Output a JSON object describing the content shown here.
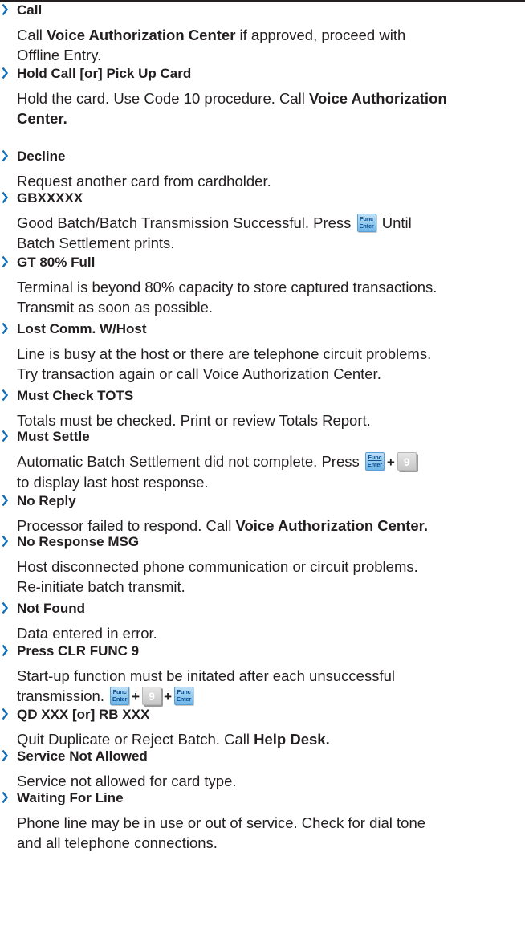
{
  "entries": [
    {
      "title": "Call",
      "desc": [
        [
          {
            "t": "Call "
          },
          {
            "t": "Voice Authorization Center",
            "b": true
          },
          {
            "t": " if approved, proceed with"
          }
        ],
        [
          {
            "t": "Offline Entry."
          }
        ]
      ]
    },
    {
      "title": "Hold Call [or] Pick Up Card",
      "desc": [
        [
          {
            "t": "Hold the card. Use Code 10 procedure. Call "
          },
          {
            "t": "Voice Authorization",
            "b": true
          }
        ],
        [
          {
            "t": "Center.",
            "b": true
          }
        ]
      ]
    },
    {
      "title": "Decline",
      "desc": [
        [
          {
            "t": "Request another card from cardholder."
          }
        ]
      ]
    },
    {
      "title": "GBXXXXX",
      "desc": [
        [
          {
            "t": "Good Batch/Batch Transmission Successful. Press "
          },
          {
            "k": "func"
          },
          {
            "t": " Until"
          }
        ],
        [
          {
            "t": "Batch Settlement prints."
          }
        ]
      ]
    },
    {
      "title": "GT 80% Full",
      "desc": [
        [
          {
            "t": "Terminal is beyond 80% capacity to store captured transactions."
          }
        ],
        [
          {
            "t": "Transmit as soon as possible."
          }
        ]
      ]
    },
    {
      "title": "Lost Comm. W/Host",
      "desc": [
        [
          {
            "t": "Line is busy at the host or there are telephone circuit problems."
          }
        ],
        [
          {
            "t": "Try transaction again or call Voice Authorization Center."
          }
        ]
      ]
    },
    {
      "title": "Must Check TOTS",
      "desc": [
        [
          {
            "t": "Totals must be checked. Print or review Totals Report."
          }
        ]
      ]
    },
    {
      "title": "Must Settle",
      "desc": [
        [
          {
            "t": "Automatic Batch Settlement did not complete. Press "
          },
          {
            "k": "func"
          },
          {
            "t": " + ",
            "plus": true
          },
          {
            "k": "num",
            "v": "9"
          }
        ],
        [
          {
            "t": "to display last host response."
          }
        ]
      ]
    },
    {
      "title": "No Reply",
      "desc": [
        [
          {
            "t": "Processor failed to respond. Call "
          },
          {
            "t": "Voice Authorization Center.",
            "b": true
          }
        ]
      ]
    },
    {
      "title": "No Response MSG",
      "desc": [
        [
          {
            "t": "Host disconnected phone communication or circuit problems."
          }
        ],
        [
          {
            "t": "Re-initiate batch transmit."
          }
        ]
      ]
    },
    {
      "title": "Not Found",
      "desc": [
        [
          {
            "t": "Data entered in error."
          }
        ]
      ]
    },
    {
      "title": "Press CLR FUNC 9",
      "desc": [
        [
          {
            "t": "Start-up function must be initated after each unsuccessful"
          }
        ],
        [
          {
            "t": "transmission. "
          },
          {
            "k": "func"
          },
          {
            "t": " + ",
            "plus": true
          },
          {
            "k": "num",
            "v": "9"
          },
          {
            "t": " + ",
            "plus": true
          },
          {
            "k": "func"
          }
        ]
      ]
    },
    {
      "title": "QD XXX [or] RB XXX",
      "desc": [
        [
          {
            "t": "Quit Duplicate or Reject Batch. Call "
          },
          {
            "t": "Help Desk.",
            "b": true
          }
        ]
      ]
    },
    {
      "title": "Service Not Allowed",
      "desc": [
        [
          {
            "t": "Service not allowed for card type."
          }
        ]
      ]
    },
    {
      "title": "Waiting For Line",
      "desc": [
        [
          {
            "t": "Phone line may be in use or out of service. Check for dial tone"
          }
        ],
        [
          {
            "t": "and all telephone connections."
          }
        ]
      ]
    }
  ],
  "keys": {
    "func_line1": "Func",
    "func_line2": "Enter"
  },
  "colors": {
    "bullet": "#0f6fba",
    "text": "#231f20"
  }
}
